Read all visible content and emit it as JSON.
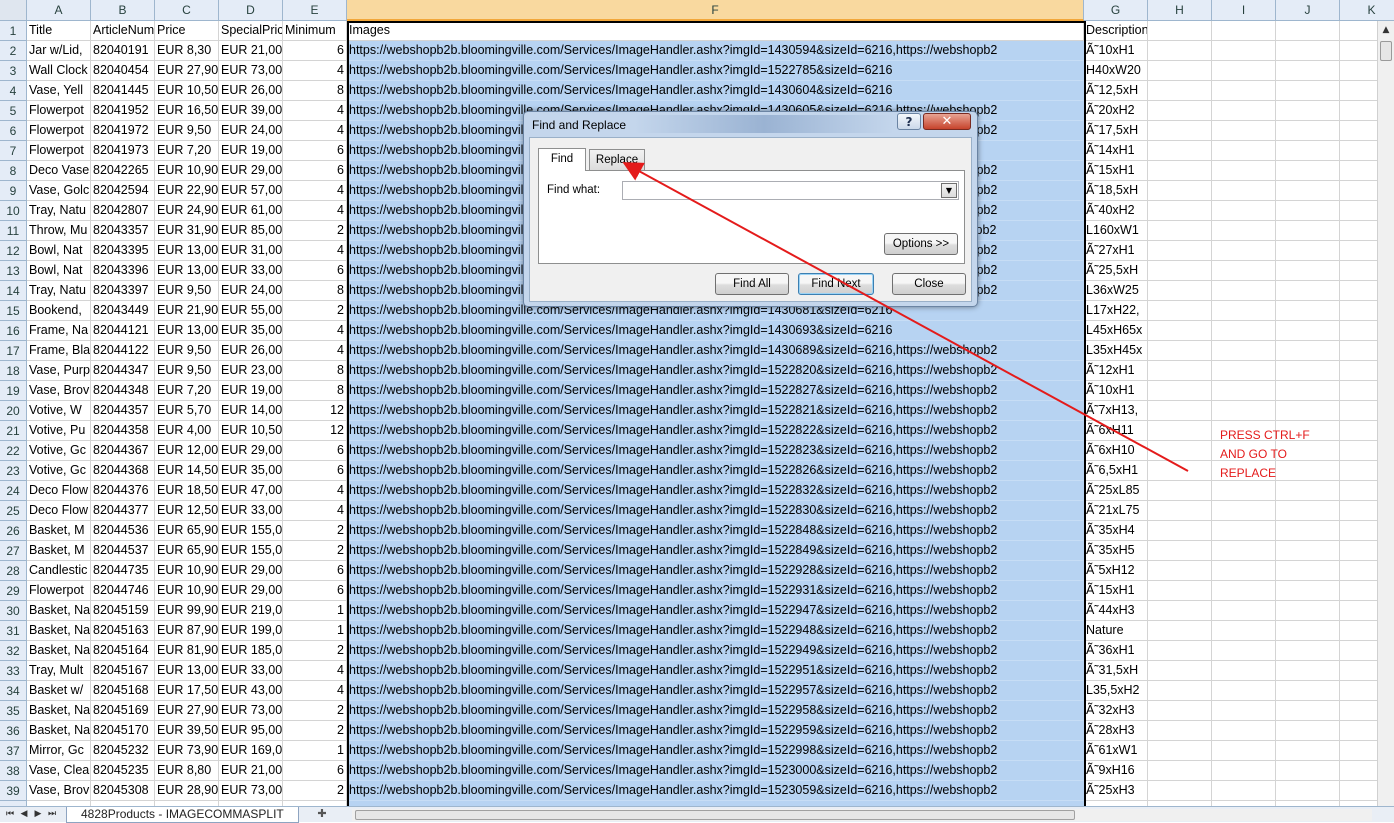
{
  "columns": [
    {
      "letter": "A",
      "w": 64
    },
    {
      "letter": "B",
      "w": 64
    },
    {
      "letter": "C",
      "w": 64
    },
    {
      "letter": "D",
      "w": 64
    },
    {
      "letter": "E",
      "w": 64
    },
    {
      "letter": "F",
      "w": 737
    },
    {
      "letter": "G",
      "w": 64
    },
    {
      "letter": "H",
      "w": 64
    },
    {
      "letter": "I",
      "w": 64
    },
    {
      "letter": "J",
      "w": 64
    },
    {
      "letter": "K",
      "w": 64
    }
  ],
  "rows": [
    [
      "Title",
      "ArticleNumber",
      "Price",
      "SpecialPrice",
      "Minimum",
      "Images",
      "Description"
    ],
    [
      "Jar w/Lid,",
      "82040191",
      "EUR 8,30",
      "EUR 21,00",
      "6",
      "https://webshopb2b.bloomingville.com/Services/ImageHandler.ashx?imgId=1430594&sizeId=6216,https://webshopb2",
      "Ã˜10xH1"
    ],
    [
      "Wall Clock",
      "82040454",
      "EUR 27,90",
      "EUR 73,00",
      "4",
      "https://webshopb2b.bloomingville.com/Services/ImageHandler.ashx?imgId=1522785&sizeId=6216",
      "H40xW20"
    ],
    [
      "Vase, Yell",
      "82041445",
      "EUR 10,50",
      "EUR 26,00",
      "8",
      "https://webshopb2b.bloomingville.com/Services/ImageHandler.ashx?imgId=1430604&sizeId=6216",
      "Ã˜12,5xH"
    ],
    [
      "Flowerpot",
      "82041952",
      "EUR 16,50",
      "EUR 39,00",
      "4",
      "https://webshopb2b.bloomingville.com/Services/ImageHandler.ashx?imgId=1430605&sizeId=6216,https://webshopb2",
      "Ã˜20xH2"
    ],
    [
      "Flowerpot",
      "82041972",
      "EUR 9,50",
      "EUR 24,00",
      "4",
      "https://webshopb2b.bloomingville.com/Services/ImageHandler.ashx?imgId=1430606&sizeId=6216,https://webshopb2",
      "Ã˜17,5xH"
    ],
    [
      "Flowerpot",
      "82041973",
      "EUR 7,20",
      "EUR 19,00",
      "6",
      "https://webshopb2b.bloomingville.com/Services/ImageHandler.ashx?imgId=1430607&sizeId=6216",
      "Ã˜14xH1"
    ],
    [
      "Deco Vase",
      "82042265",
      "EUR 10,90",
      "EUR 29,00",
      "6",
      "https://webshopb2b.bloomingville.com/Services/ImageHandler.ashx?imgId=1430608&sizeId=6216,https://webshopb2",
      "Ã˜15xH1"
    ],
    [
      "Vase, Golc",
      "82042594",
      "EUR 22,90",
      "EUR 57,00",
      "4",
      "https://webshopb2b.bloomingville.com/Services/ImageHandler.ashx?imgId=1430609&sizeId=6216,https://webshopb2",
      "Ã˜18,5xH"
    ],
    [
      "Tray, Natu",
      "82042807",
      "EUR 24,90",
      "EUR 61,00",
      "4",
      "https://webshopb2b.bloomingville.com/Services/ImageHandler.ashx?imgId=1430610&sizeId=6216,https://webshopb2",
      "Ã˜40xH2"
    ],
    [
      "Throw, Mu",
      "82043357",
      "EUR 31,90",
      "EUR 85,00",
      "2",
      "https://webshopb2b.bloomingville.com/Services/ImageHandler.ashx?imgId=1430611&sizeId=6216,https://webshopb2",
      "L160xW1"
    ],
    [
      "Bowl, Nat",
      "82043395",
      "EUR 13,00",
      "EUR 31,00",
      "4",
      "https://webshopb2b.bloomingville.com/Services/ImageHandler.ashx?imgId=1430612&sizeId=6216,https://webshopb2",
      "Ã˜27xH1"
    ],
    [
      "Bowl, Nat",
      "82043396",
      "EUR 13,00",
      "EUR 33,00",
      "6",
      "https://webshopb2b.bloomingville.com/Services/ImageHandler.ashx?imgId=1430613&sizeId=6216,https://webshopb2",
      "Ã˜25,5xH"
    ],
    [
      "Tray, Natu",
      "82043397",
      "EUR 9,50",
      "EUR 24,00",
      "8",
      "https://webshopb2b.bloomingville.com/Services/ImageHandler.ashx?imgId=1430614&sizeId=6216,https://webshopb2",
      "L36xW25"
    ],
    [
      "Bookend,",
      "82043449",
      "EUR 21,90",
      "EUR 55,00",
      "2",
      "https://webshopb2b.bloomingville.com/Services/ImageHandler.ashx?imgId=1430681&sizeId=6216",
      "L17xH22,"
    ],
    [
      "Frame, Na",
      "82044121",
      "EUR 13,00",
      "EUR 35,00",
      "4",
      "https://webshopb2b.bloomingville.com/Services/ImageHandler.ashx?imgId=1430693&sizeId=6216",
      "L45xH65x"
    ],
    [
      "Frame, Bla",
      "82044122",
      "EUR 9,50",
      "EUR 26,00",
      "4",
      "https://webshopb2b.bloomingville.com/Services/ImageHandler.ashx?imgId=1430689&sizeId=6216,https://webshopb2",
      "L35xH45x"
    ],
    [
      "Vase, Purp",
      "82044347",
      "EUR 9,50",
      "EUR 23,00",
      "8",
      "https://webshopb2b.bloomingville.com/Services/ImageHandler.ashx?imgId=1522820&sizeId=6216,https://webshopb2",
      "Ã˜12xH1"
    ],
    [
      "Vase, Brov",
      "82044348",
      "EUR 7,20",
      "EUR 19,00",
      "8",
      "https://webshopb2b.bloomingville.com/Services/ImageHandler.ashx?imgId=1522827&sizeId=6216,https://webshopb2",
      "Ã˜10xH1"
    ],
    [
      "Votive, W",
      "82044357",
      "EUR 5,70",
      "EUR 14,00",
      "12",
      "https://webshopb2b.bloomingville.com/Services/ImageHandler.ashx?imgId=1522821&sizeId=6216,https://webshopb2",
      "Ã˜7xH13,"
    ],
    [
      "Votive, Pu",
      "82044358",
      "EUR 4,00",
      "EUR 10,50",
      "12",
      "https://webshopb2b.bloomingville.com/Services/ImageHandler.ashx?imgId=1522822&sizeId=6216,https://webshopb2",
      "Ã˜6xH11"
    ],
    [
      "Votive, Gc",
      "82044367",
      "EUR 12,00",
      "EUR 29,00",
      "6",
      "https://webshopb2b.bloomingville.com/Services/ImageHandler.ashx?imgId=1522823&sizeId=6216,https://webshopb2",
      "Ã˜6xH10"
    ],
    [
      "Votive, Gc",
      "82044368",
      "EUR 14,50",
      "EUR 35,00",
      "6",
      "https://webshopb2b.bloomingville.com/Services/ImageHandler.ashx?imgId=1522826&sizeId=6216,https://webshopb2",
      "Ã˜6,5xH1"
    ],
    [
      "Deco Flow",
      "82044376",
      "EUR 18,50",
      "EUR 47,00",
      "4",
      "https://webshopb2b.bloomingville.com/Services/ImageHandler.ashx?imgId=1522832&sizeId=6216,https://webshopb2",
      "Ã˜25xL85"
    ],
    [
      "Deco Flow",
      "82044377",
      "EUR 12,50",
      "EUR 33,00",
      "4",
      "https://webshopb2b.bloomingville.com/Services/ImageHandler.ashx?imgId=1522830&sizeId=6216,https://webshopb2",
      "Ã˜21xL75"
    ],
    [
      "Basket, M",
      "82044536",
      "EUR 65,90",
      "EUR 155,00",
      "2",
      "https://webshopb2b.bloomingville.com/Services/ImageHandler.ashx?imgId=1522848&sizeId=6216,https://webshopb2",
      "Ã˜35xH4"
    ],
    [
      "Basket, M",
      "82044537",
      "EUR 65,90",
      "EUR 155,00",
      "2",
      "https://webshopb2b.bloomingville.com/Services/ImageHandler.ashx?imgId=1522849&sizeId=6216,https://webshopb2",
      "Ã˜35xH5"
    ],
    [
      "Candlestic",
      "82044735",
      "EUR 10,90",
      "EUR 29,00",
      "6",
      "https://webshopb2b.bloomingville.com/Services/ImageHandler.ashx?imgId=1522928&sizeId=6216,https://webshopb2",
      "Ã˜5xH12"
    ],
    [
      "Flowerpot",
      "82044746",
      "EUR 10,90",
      "EUR 29,00",
      "6",
      "https://webshopb2b.bloomingville.com/Services/ImageHandler.ashx?imgId=1522931&sizeId=6216,https://webshopb2",
      "Ã˜15xH1"
    ],
    [
      "Basket, Na",
      "82045159",
      "EUR 99,90",
      "EUR 219,00",
      "1",
      "https://webshopb2b.bloomingville.com/Services/ImageHandler.ashx?imgId=1522947&sizeId=6216,https://webshopb2",
      "Ã˜44xH3"
    ],
    [
      "Basket, Na",
      "82045163",
      "EUR 87,90",
      "EUR 199,00",
      "1",
      "https://webshopb2b.bloomingville.com/Services/ImageHandler.ashx?imgId=1522948&sizeId=6216,https://webshopb2",
      "Nature"
    ],
    [
      "Basket, Na",
      "82045164",
      "EUR 81,90",
      "EUR 185,00",
      "2",
      "https://webshopb2b.bloomingville.com/Services/ImageHandler.ashx?imgId=1522949&sizeId=6216,https://webshopb2",
      "Ã˜36xH1"
    ],
    [
      "Tray, Mult",
      "82045167",
      "EUR 13,00",
      "EUR 33,00",
      "4",
      "https://webshopb2b.bloomingville.com/Services/ImageHandler.ashx?imgId=1522951&sizeId=6216,https://webshopb2",
      "Ã˜31,5xH"
    ],
    [
      "Basket w/",
      "82045168",
      "EUR 17,50",
      "EUR 43,00",
      "4",
      "https://webshopb2b.bloomingville.com/Services/ImageHandler.ashx?imgId=1522957&sizeId=6216,https://webshopb2",
      "L35,5xH2"
    ],
    [
      "Basket, Na",
      "82045169",
      "EUR 27,90",
      "EUR 73,00",
      "2",
      "https://webshopb2b.bloomingville.com/Services/ImageHandler.ashx?imgId=1522958&sizeId=6216,https://webshopb2",
      "Ã˜32xH3"
    ],
    [
      "Basket, Na",
      "82045170",
      "EUR 39,50",
      "EUR 95,00",
      "2",
      "https://webshopb2b.bloomingville.com/Services/ImageHandler.ashx?imgId=1522959&sizeId=6216,https://webshopb2",
      "Ã˜28xH3"
    ],
    [
      "Mirror, Gc",
      "82045232",
      "EUR 73,90",
      "EUR 169,00",
      "1",
      "https://webshopb2b.bloomingville.com/Services/ImageHandler.ashx?imgId=1522998&sizeId=6216,https://webshopb2",
      "Ã˜61xW1"
    ],
    [
      "Vase, Clea",
      "82045235",
      "EUR 8,80",
      "EUR 21,00",
      "6",
      "https://webshopb2b.bloomingville.com/Services/ImageHandler.ashx?imgId=1523000&sizeId=6216,https://webshopb2",
      "Ã˜9xH16"
    ],
    [
      "Vase, Brov",
      "82045308",
      "EUR 28,90",
      "EUR 73,00",
      "2",
      "https://webshopb2b.bloomingville.com/Services/ImageHandler.ashx?imgId=1523059&sizeId=6216,https://webshopb2",
      "Ã˜25xH3"
    ]
  ],
  "sheet_tab": "4828Products - IMAGECOMMASPLIT",
  "annotation": "PRESS CTRL+F\nAND GO TO\nREPLACE",
  "dialog": {
    "title": "Find and Replace",
    "help": "?",
    "close": "✕",
    "tab_find": "Find",
    "tab_replace": "Replace",
    "find_what_label": "Find what:",
    "find_what_value": "",
    "options_button": "Options >>",
    "find_all_button": "Find All",
    "find_next_button": "Find Next",
    "close_button": "Close"
  },
  "colors": {
    "selection": "#b7d3f2",
    "annotation": "#e41b1b"
  },
  "icons": {
    "dropdown": "▼",
    "nav_first": "⏮",
    "nav_prev": "◀",
    "nav_next": "▶",
    "nav_last": "⏭",
    "scroll_up": "▲",
    "new_sheet": "✚"
  }
}
